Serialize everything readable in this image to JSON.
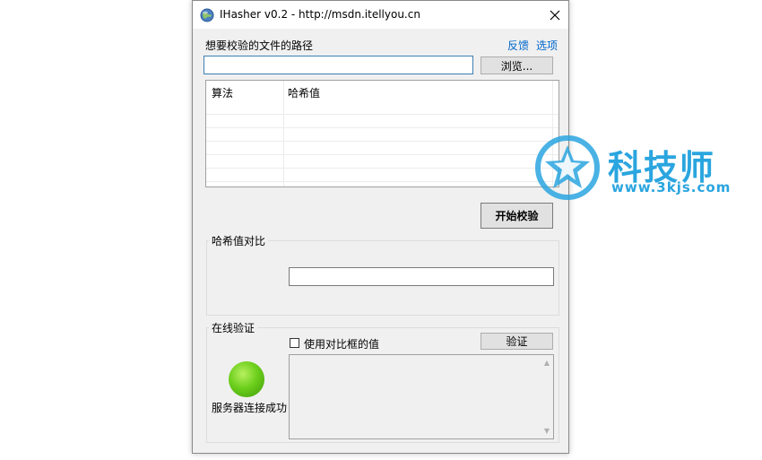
{
  "window": {
    "title": "IHasher v0.2 - http://msdn.itellyou.cn"
  },
  "file_section": {
    "label": "想要校验的文件的路径",
    "feedback_link": "反馈",
    "options_link": "选项",
    "path_value": "",
    "browse_label": "浏览..."
  },
  "hash_table": {
    "columns": [
      "算法",
      "哈希值"
    ],
    "rows": []
  },
  "start_button": "开始校验",
  "compare_group": {
    "title": "哈希值对比",
    "value": ""
  },
  "online_group": {
    "title": "在线验证",
    "checkbox_label": "使用对比框的值",
    "checkbox_checked": false,
    "verify_label": "验证",
    "status_text": "服务器连接成功",
    "status_color": "#6ccf1c",
    "result_text": ""
  },
  "watermark": {
    "title": "科技师",
    "subtitle": "www.3kjs.com"
  },
  "colors": {
    "link": "#0066cc",
    "window_bg": "#f0f0f0",
    "watermark": "#2aa5df"
  }
}
